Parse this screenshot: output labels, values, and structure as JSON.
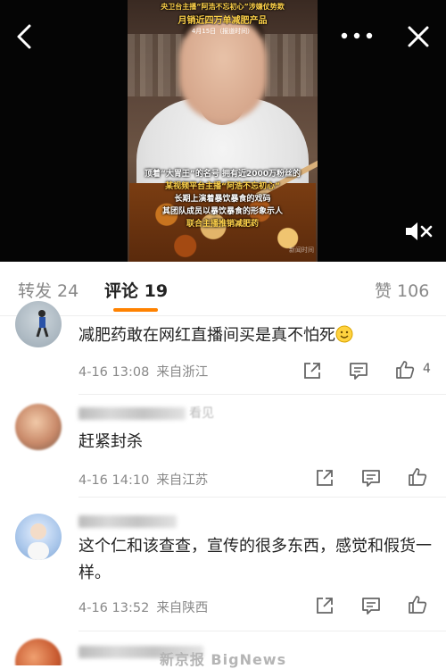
{
  "video": {
    "overlay_headline_1": "央卫台主播“阿浩不忘初心”涉嫌仗势欺",
    "overlay_headline_2": "月销近四万单减肥产品",
    "overlay_date": "4月15日（报道时间）",
    "overlay_caption_lines": [
      "顶着“大胃王”的名号 拥有近2000万粉丝的",
      "某视频平台主播“阿浩不忘初心”",
      "长期上演着暴饮暴食的戏码",
      "其团队成员以暴饮暴食的形象示人",
      "联合主播推销减肥药"
    ],
    "watermark": "新闻时间"
  },
  "tabs": [
    {
      "label": "转发 24",
      "active": false
    },
    {
      "label": "评论 19",
      "active": true
    },
    {
      "label": "赞 106",
      "active": false
    }
  ],
  "comments": [
    {
      "text": "减肥药敢在网红直播间买是真不怕死",
      "emoji": "smile-emoji",
      "time": "4-16 13:08",
      "source": "来自浙江",
      "like_count": "4"
    },
    {
      "username_partial": "看见",
      "text": "赶紧封杀",
      "time": "4-16 14:10",
      "source": "来自江苏",
      "like_count": ""
    },
    {
      "text": "这个仁和该查查，宣传的很多东西，感觉和假货一样。",
      "time": "4-16 13:52",
      "source": "来自陕西",
      "like_count": ""
    }
  ],
  "footer_watermark": "新京报 BigNews",
  "icons": {
    "back": "chevron-left-icon",
    "more": "more-dots-icon",
    "close": "close-icon",
    "mute": "volume-mute-icon",
    "share": "share-icon",
    "reply": "comment-icon",
    "like": "thumb-up-icon"
  },
  "colors": {
    "accent": "#ff8200",
    "text": "#222222",
    "meta": "#888888"
  }
}
